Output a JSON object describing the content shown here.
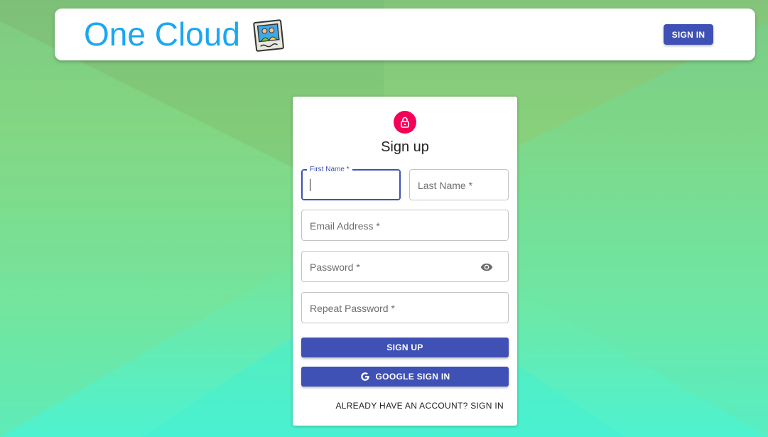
{
  "header": {
    "brand": "One Cloud",
    "logo_icon": "photo-frame-icon",
    "signin_label": "SIGN IN"
  },
  "form": {
    "icon": "lock-icon",
    "title": "Sign up",
    "first_name_label": "First Name *",
    "first_name_value": "",
    "last_name_placeholder": "Last Name *",
    "email_placeholder": "Email Address *",
    "password_placeholder": "Password *",
    "password_toggle_icon": "eye-icon",
    "repeat_password_placeholder": "Repeat Password *",
    "signup_label": "SIGN UP",
    "google_icon": "google-icon",
    "google_label": "GOOGLE SIGN IN",
    "signin_link": "ALREADY HAVE AN ACCOUNT? SIGN IN"
  },
  "colors": {
    "brand": "#1ba7f0",
    "primary": "#3f51b5",
    "accent": "#f50057"
  }
}
